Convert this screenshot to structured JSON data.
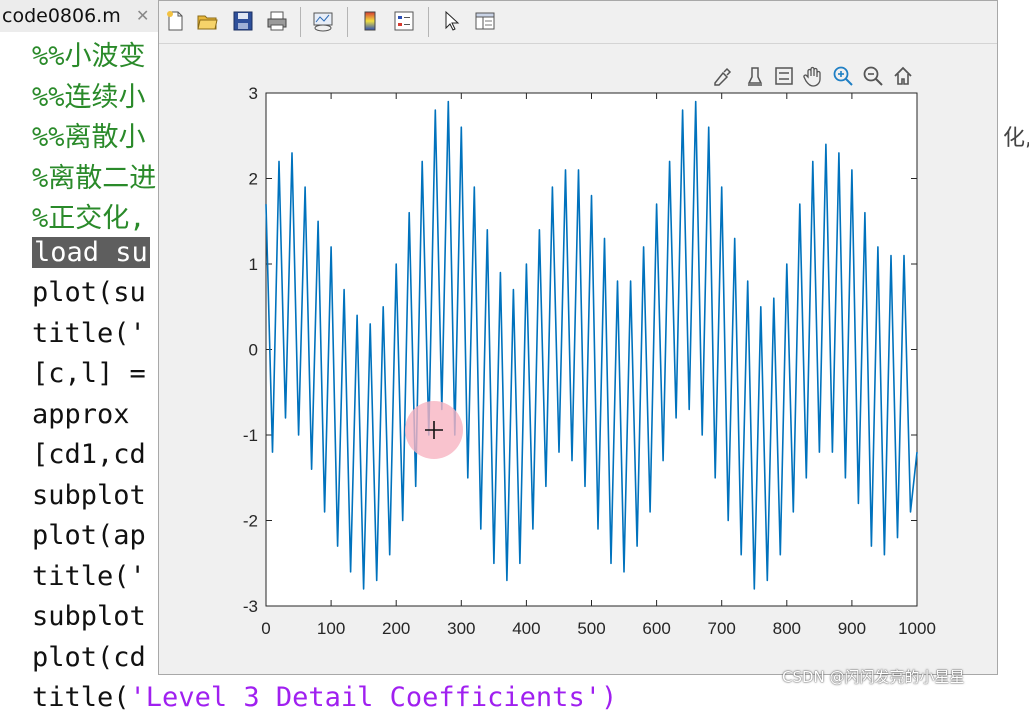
{
  "editor": {
    "tab_label": "code0806.m",
    "tab_close": "✕",
    "lines": [
      {
        "text": "%%小波变",
        "kind": "comment"
      },
      {
        "text": "%%连续小",
        "kind": "comment"
      },
      {
        "text": "%%离散小",
        "kind": "comment"
      },
      {
        "text": "%离散二进",
        "kind": "comment"
      },
      {
        "text": "%正交化,",
        "kind": "comment"
      },
      {
        "text": "load su",
        "kind": "highlight"
      },
      {
        "text": "plot(su",
        "kind": "code"
      },
      {
        "text": "title('",
        "kind": "code"
      },
      {
        "text": "[c,l] =",
        "kind": "code"
      },
      {
        "text": "approx ",
        "kind": "code"
      },
      {
        "text": "[cd1,cd",
        "kind": "code"
      },
      {
        "text": "subplot",
        "kind": "code"
      },
      {
        "text": "plot(ap",
        "kind": "code"
      },
      {
        "text": "title('",
        "kind": "code"
      },
      {
        "text": "subplot",
        "kind": "code"
      },
      {
        "text": "plot(cd",
        "kind": "code"
      },
      {
        "text": "title('Level 3 Detail Coefficients')",
        "kind": "code"
      }
    ],
    "right_fragment": "化,"
  },
  "figure": {
    "toolbar_icons": [
      "new-figure-icon",
      "open-folder-icon",
      "save-icon",
      "print-icon",
      "link-plot-icon",
      "insert-colorbar-icon",
      "insert-legend-icon",
      "edit-plot-arrow-icon",
      "property-inspector-icon"
    ],
    "axes_toolbar_icons": [
      "brush-icon",
      "data-tips-icon",
      "insert-legend-axes-icon",
      "pan-hand-icon",
      "zoom-in-icon",
      "zoom-out-icon",
      "restore-view-icon"
    ]
  },
  "colors": {
    "line": "#0072bd",
    "comment": "#2a8a2a",
    "cursor_highlight": "#f7b4c2"
  },
  "chart_data": {
    "type": "line",
    "title": "",
    "xlabel": "",
    "ylabel": "",
    "xlim": [
      0,
      1000
    ],
    "ylim": [
      -3,
      3
    ],
    "xticks": [
      0,
      100,
      200,
      300,
      400,
      500,
      600,
      700,
      800,
      900,
      1000
    ],
    "xtick_labels": [
      "0",
      "100",
      "200",
      "300",
      "400",
      "500",
      "600",
      "700",
      "800",
      "900",
      "1000"
    ],
    "yticks": [
      -3,
      -2,
      -1,
      0,
      1,
      2,
      3
    ],
    "ytick_labels": [
      "-3",
      "-2",
      "-1",
      "0",
      "1",
      "2",
      "3"
    ],
    "grid": false,
    "series": [
      {
        "x": [
          0,
          10,
          20,
          30,
          40,
          50,
          60,
          70,
          80,
          90,
          100,
          110,
          120,
          130,
          140,
          150,
          160,
          170,
          180,
          190,
          200,
          210,
          220,
          230,
          240,
          250,
          260,
          270,
          280,
          290,
          300,
          310,
          320,
          330,
          340,
          350,
          360,
          370,
          380,
          390,
          400,
          410,
          420,
          430,
          440,
          450,
          460,
          470,
          480,
          490,
          500,
          510,
          520,
          530,
          540,
          550,
          560,
          570,
          580,
          590,
          600,
          610,
          620,
          630,
          640,
          650,
          660,
          670,
          680,
          690,
          700,
          710,
          720,
          730,
          740,
          750,
          760,
          770,
          780,
          790,
          800,
          810,
          820,
          830,
          840,
          850,
          860,
          870,
          880,
          890,
          900,
          910,
          920,
          930,
          940,
          950,
          960,
          970,
          980,
          990,
          1000
        ],
        "y": [
          1.7,
          -1.2,
          2.2,
          -0.8,
          2.3,
          -1.0,
          1.9,
          -1.4,
          1.5,
          -1.9,
          1.2,
          -2.3,
          0.7,
          -2.6,
          0.4,
          -2.8,
          0.3,
          -2.7,
          0.5,
          -2.4,
          1.0,
          -2.0,
          1.6,
          -1.6,
          2.2,
          -1.0,
          2.8,
          -0.7,
          2.9,
          -1.0,
          2.6,
          -1.5,
          1.9,
          -2.1,
          1.4,
          -2.5,
          0.9,
          -2.7,
          0.7,
          -2.5,
          1.0,
          -2.1,
          1.4,
          -1.6,
          1.9,
          -1.2,
          2.1,
          -1.3,
          2.1,
          -1.6,
          1.8,
          -2.1,
          1.3,
          -2.5,
          0.8,
          -2.6,
          0.8,
          -2.3,
          1.2,
          -1.9,
          1.7,
          -1.3,
          2.2,
          -0.8,
          2.8,
          -0.7,
          2.9,
          -1.0,
          2.6,
          -1.5,
          1.9,
          -2.0,
          1.3,
          -2.4,
          0.8,
          -2.8,
          0.5,
          -2.7,
          0.6,
          -2.4,
          1.0,
          -1.9,
          1.7,
          -1.5,
          2.2,
          -1.2,
          2.4,
          -1.2,
          2.3,
          -1.5,
          2.1,
          -1.8,
          1.6,
          -2.3,
          1.2,
          -2.4,
          1.1,
          -2.2,
          1.1,
          -1.9,
          -1.2
        ]
      }
    ]
  }
}
